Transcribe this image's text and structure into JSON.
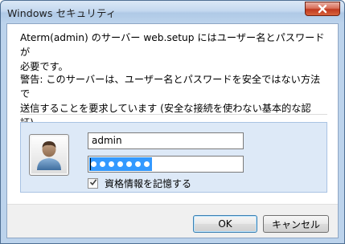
{
  "window": {
    "title": "Windows セキュリティ"
  },
  "message": {
    "line1": "Aterm(admin) のサーバー web.setup にはユーザー名とパスワードが\n必要です。",
    "line2": "警告: このサーバーは、ユーザー名とパスワードを安全ではない方法で\n送信することを要求しています (安全な接続を使わない基本的な認証)。"
  },
  "credentials": {
    "username_value": "admin",
    "password_mask_count": 7,
    "remember_label": "資格情報を記憶する",
    "remember_checked": true
  },
  "buttons": {
    "ok_label": "OK",
    "cancel_label": "キャンセル"
  },
  "icons": {
    "close": "close-icon",
    "user_tile": "user-avatar-icon",
    "checkmark": "checkmark-icon"
  },
  "colors": {
    "title_bar": "#bcd3ec",
    "close_button": "#c0391f",
    "panel_background": "#dde9f7",
    "selection": "#3399ff"
  }
}
